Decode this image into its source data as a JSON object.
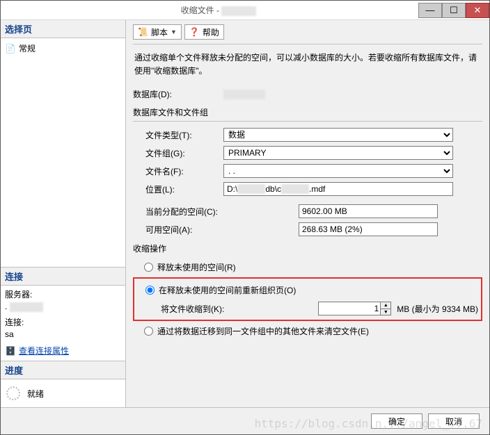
{
  "titlebar": {
    "title": "收缩文件 -"
  },
  "sidebar": {
    "select_header": "选择页",
    "general_item": "常规",
    "connection_header": "连接",
    "server_label": "服务器:",
    "server_value": ". ",
    "conn_label": "连接:",
    "conn_value": "sa",
    "view_conn_props": "查看连接属性",
    "progress_header": "进度",
    "progress_status": "就绪"
  },
  "toolbar": {
    "script": "脚本",
    "help": "帮助"
  },
  "desc": "通过收缩单个文件释放未分配的空间，可以减小数据库的大小。若要收缩所有数据库文件，请使用\"收缩数据库\"。",
  "form": {
    "database_label": "数据库(D):",
    "filegroup_title": "数据库文件和文件组",
    "file_type_label": "文件类型(T):",
    "file_type_value": "数据",
    "filegroup_label": "文件组(G):",
    "filegroup_value": "PRIMARY",
    "filename_label": "文件名(F):",
    "filename_value": ". .",
    "loc_label": "位置(L):",
    "loc_value_prefix": "D:\\",
    "loc_value_mid": "db\\c",
    "loc_value_suffix": ".mdf",
    "allocated_label": "当前分配的空间(C):",
    "allocated_value": "9602.00 MB",
    "avail_label": "可用空间(A):",
    "avail_value": "268.63 MB (2%)"
  },
  "shrink": {
    "title": "收缩操作",
    "radio1": "释放未使用的空间(R)",
    "radio2": "在释放未使用的空间前重新组织页(O)",
    "shrink_to_label": "将文件收缩到(K):",
    "shrink_to_value": "1",
    "shrink_to_suffix": "MB (最小为 9334 MB)",
    "radio3": "通过将数据迁移到同一文件组中的其他文件来清空文件(E)"
  },
  "footer": {
    "ok": "确定",
    "cancel": "取消"
  },
  "watermark": "https://blog.csdn.n.../angel_...67"
}
